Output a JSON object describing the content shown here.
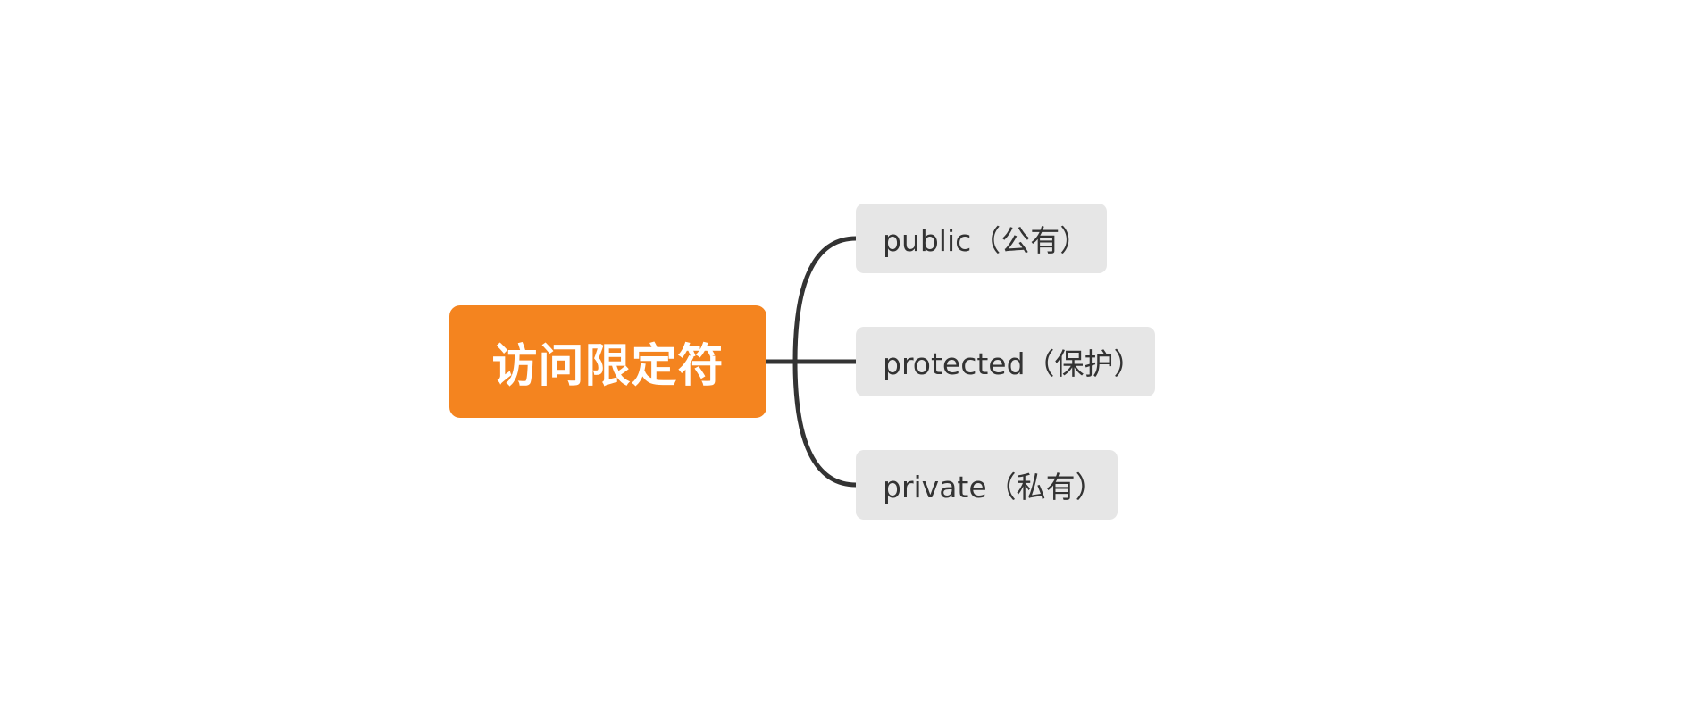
{
  "root": {
    "label": "访问限定符",
    "color": "#f4841f"
  },
  "children": [
    {
      "label": "public（公有）"
    },
    {
      "label": "protected（保护）"
    },
    {
      "label": "private（私有）"
    }
  ],
  "colors": {
    "child_background": "#e6e6e6",
    "connector": "#333333",
    "child_text": "#333333",
    "root_text": "#ffffff"
  }
}
